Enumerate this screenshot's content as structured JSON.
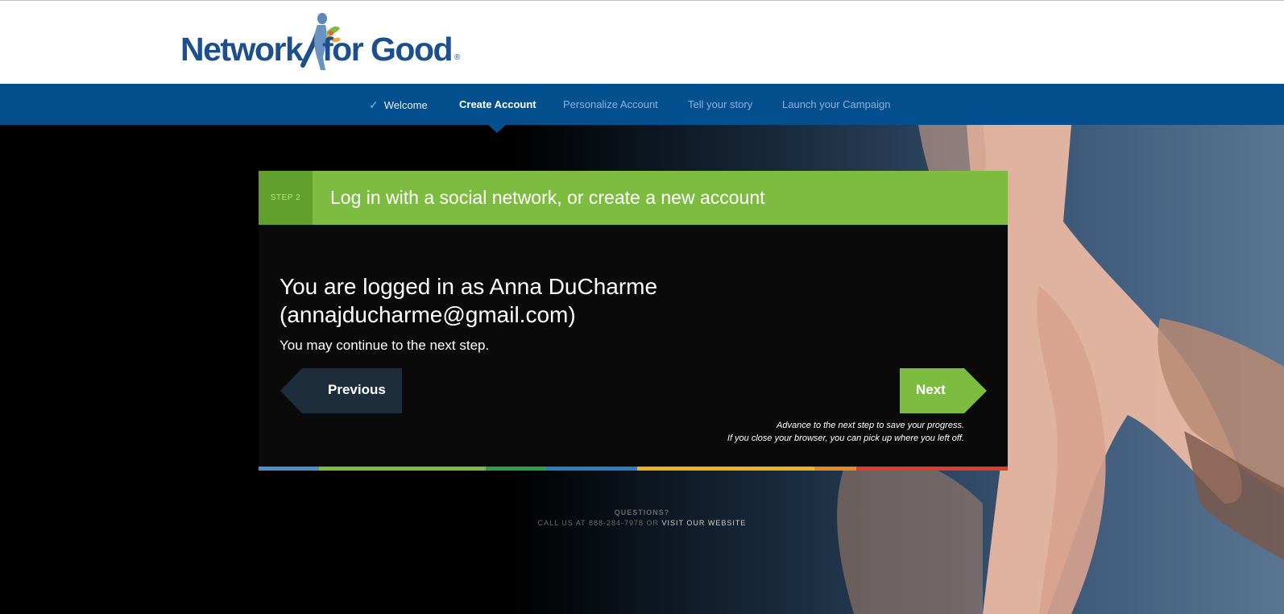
{
  "brand": {
    "name_part1": "Network",
    "name_part2": "for Good",
    "registered_mark": "®",
    "colors": {
      "blue": "#1d4f8c",
      "green": "#7dbb41",
      "nav": "#04508f"
    }
  },
  "nav": {
    "items": [
      {
        "label": "Welcome",
        "state": "done",
        "icon": "check-icon"
      },
      {
        "label": "Create Account",
        "state": "active"
      },
      {
        "label": "Personalize Account",
        "state": "upcoming"
      },
      {
        "label": "Tell your story",
        "state": "upcoming"
      },
      {
        "label": "Launch your Campaign",
        "state": "upcoming"
      }
    ]
  },
  "step": {
    "label": "STEP 2",
    "title": "Log in with a social network, or create a new account"
  },
  "main": {
    "logged_in_text": "You are logged in as Anna DuCharme (annajducharme@gmail.com)",
    "continue_text": "You may continue to the next step.",
    "previous_label": "Previous",
    "next_label": "Next",
    "note_line1": "Advance to the next step to save your progress.",
    "note_line2": "If you close your browser, you can pick up where you left off."
  },
  "footer": {
    "questions": "QUESTIONS?",
    "call": "CALL US AT 888-284-7978 OR",
    "visit": "VISIT OUR WEBSITE"
  }
}
